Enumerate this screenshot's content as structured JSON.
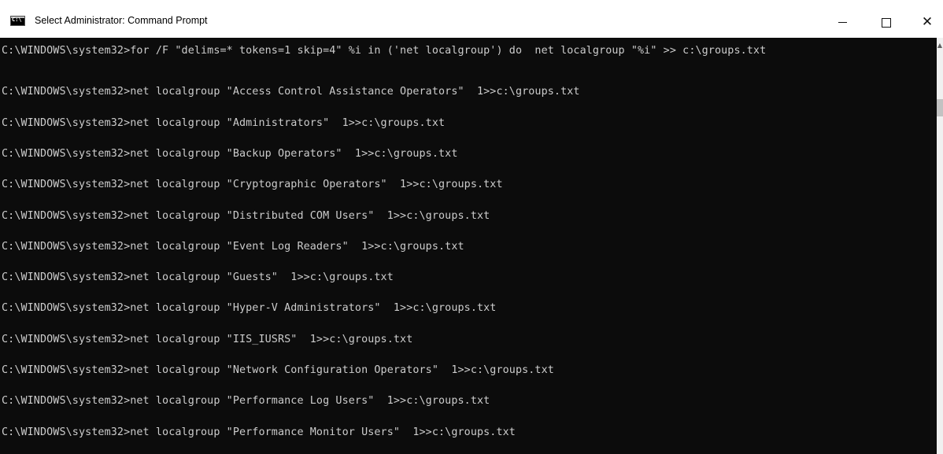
{
  "window": {
    "title": "Select Administrator: Command Prompt",
    "icon": "cmd-icon",
    "icon_text": "C:\\",
    "controls": {
      "minimize": "minimize-icon",
      "maximize": "maximize-icon",
      "close": "close-icon"
    }
  },
  "console": {
    "lines": [
      "C:\\WINDOWS\\system32>for /F \"delims=* tokens=1 skip=4\" %i in ('net localgroup') do  net localgroup \"%i\" >> c:\\groups.txt",
      "C:\\WINDOWS\\system32>net localgroup \"Access Control Assistance Operators\"  1>>c:\\groups.txt",
      "C:\\WINDOWS\\system32>net localgroup \"Administrators\"  1>>c:\\groups.txt",
      "C:\\WINDOWS\\system32>net localgroup \"Backup Operators\"  1>>c:\\groups.txt",
      "C:\\WINDOWS\\system32>net localgroup \"Cryptographic Operators\"  1>>c:\\groups.txt",
      "C:\\WINDOWS\\system32>net localgroup \"Distributed COM Users\"  1>>c:\\groups.txt",
      "C:\\WINDOWS\\system32>net localgroup \"Event Log Readers\"  1>>c:\\groups.txt",
      "C:\\WINDOWS\\system32>net localgroup \"Guests\"  1>>c:\\groups.txt",
      "C:\\WINDOWS\\system32>net localgroup \"Hyper-V Administrators\"  1>>c:\\groups.txt",
      "C:\\WINDOWS\\system32>net localgroup \"IIS_IUSRS\"  1>>c:\\groups.txt",
      "C:\\WINDOWS\\system32>net localgroup \"Network Configuration Operators\"  1>>c:\\groups.txt",
      "C:\\WINDOWS\\system32>net localgroup \"Performance Log Users\"  1>>c:\\groups.txt",
      "C:\\WINDOWS\\system32>net localgroup \"Performance Monitor Users\"  1>>c:\\groups.txt"
    ]
  },
  "colors": {
    "console_bg": "#0c0c0c",
    "console_text": "#cccccc",
    "titlebar_bg": "#ffffff"
  }
}
